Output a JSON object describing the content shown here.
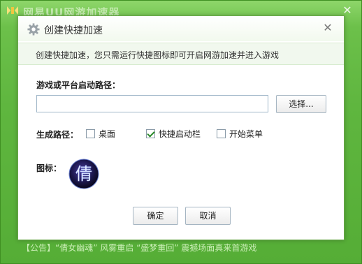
{
  "background_app": {
    "title": "网易UU网游加速器",
    "notice": "【公告】“倩女幽魂” 风雾重启 “盛梦重回” 震撼场面真来首游戏"
  },
  "dialog": {
    "title": "创建快捷加速",
    "description": "创建快捷加速，您只需运行快捷图标即可开启网游加速并进入游戏",
    "path_label": "游戏或平台启动路径：",
    "path_value": "",
    "browse_label": "选择...",
    "gen_path_label": "生成路径：",
    "options": [
      {
        "label": "桌面",
        "checked": false
      },
      {
        "label": "快捷启动栏",
        "checked": true
      },
      {
        "label": "开始菜单",
        "checked": false
      }
    ],
    "icon_label": "图标：",
    "icon_glyph": "倩",
    "ok_label": "确定",
    "cancel_label": "取消"
  },
  "colors": {
    "app_green": "#5fb63f",
    "desc_bg": "#f1f8ee",
    "check_green": "#2a8a2a"
  }
}
